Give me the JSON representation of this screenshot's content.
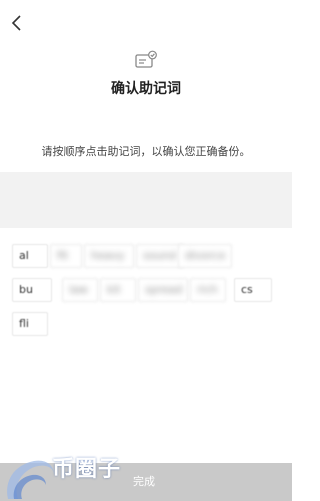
{
  "header": {
    "title": "确认助记词",
    "back_icon": "chevron-left-icon",
    "doc_icon": "document-check-icon"
  },
  "instruction": "请按顺序点击助记词，以确认您正确备份。",
  "word_rows": [
    [
      {
        "label": "al"
      },
      {
        "label": "fit"
      },
      {
        "label": "heavy"
      },
      {
        "label": "sound"
      },
      {
        "label": "divorce"
      }
    ],
    [
      {
        "label": "bu"
      },
      {
        "label": "law"
      },
      {
        "label": "kit"
      },
      {
        "label": "spread"
      },
      {
        "label": "rich"
      },
      {
        "label": "cs"
      }
    ],
    [
      {
        "label": "fli"
      }
    ]
  ],
  "complete_button": {
    "label": "完成"
  },
  "watermark": {
    "text": "币圈子"
  },
  "colors": {
    "selected_area_bg": "#f2f2f2",
    "complete_bar_bg": "#c9c9c9",
    "chip_border": "#e6e6e6"
  }
}
